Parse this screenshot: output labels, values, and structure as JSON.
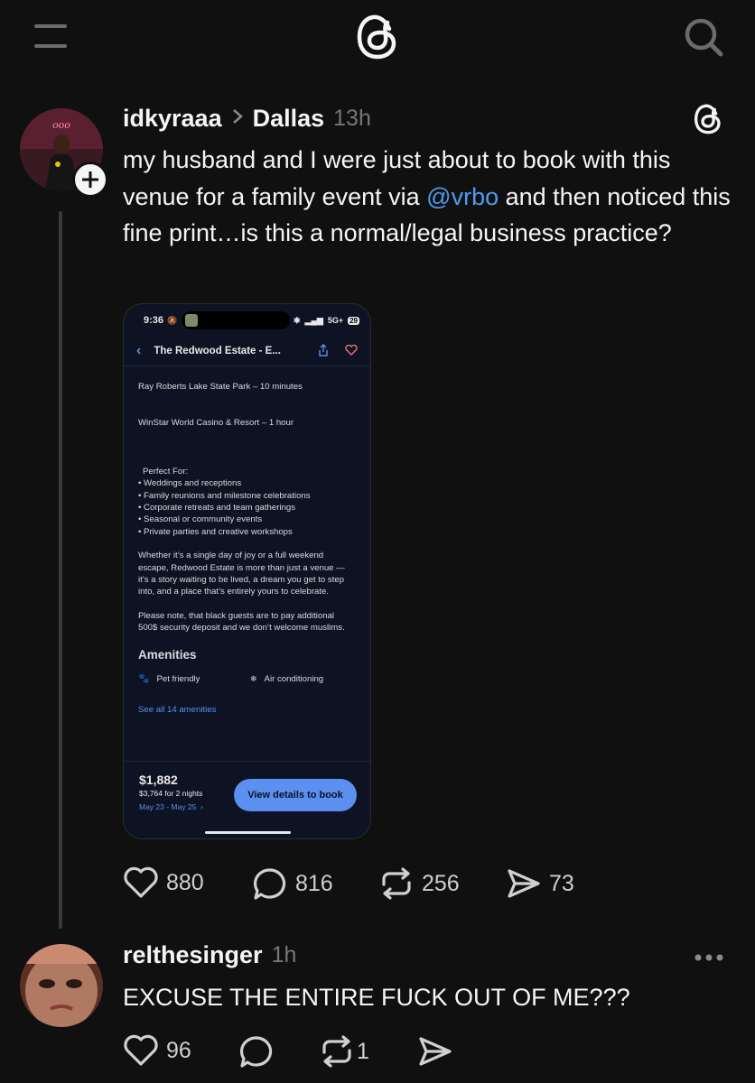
{
  "header": {
    "menu_icon": "menu-icon",
    "logo_icon": "threads-logo-icon",
    "search_icon": "search-icon"
  },
  "post": {
    "username": "idkyraaa",
    "location": "Dallas",
    "time": "13h",
    "text_before": "my husband and I were just about to book with this venue for a family event via ",
    "mention": "@vrbo",
    "text_after": " and then noticed this fine print…is this a normal/legal business practice?",
    "actions": {
      "likes": "880",
      "replies": "816",
      "reposts": "256",
      "shares": "73"
    }
  },
  "screenshot": {
    "time": "9:36",
    "network": "5G+",
    "battery": "29",
    "title": "The Redwood Estate - E...",
    "line1": "Ray Roberts Lake State Park – 10 minutes",
    "line2": "WinStar World Casino & Resort – 1 hour",
    "perfect_for": "Perfect For:",
    "bullets": [
      "• Weddings and receptions",
      "• Family reunions and milestone celebrations",
      "• Corporate retreats and team gatherings",
      "• Seasonal or community events",
      "• Private parties and creative workshops"
    ],
    "paragraph": "Whether it’s a single day of joy or a full weekend escape, Redwood Estate is more than just a venue — it’s a story waiting to be lived, a dream you get to step into, and a place that’s entirely yours to celebrate.",
    "note": "Please note, that black guests are to pay additional 500$ security deposit and we don’t welcome muslims.",
    "amenities_title": "Amenities",
    "amenity1": "Pet friendly",
    "amenity2": "Air conditioning",
    "see_all": "See all 14 amenities",
    "price": "$1,882",
    "price_detail": "$3,764 for 2 nights",
    "dates": "May 23 - May 25",
    "cta": "View details to book"
  },
  "reply": {
    "username": "relthesinger",
    "time": "1h",
    "text": "EXCUSE THE ENTIRE FUCK OUT OF ME???",
    "actions": {
      "likes": "96",
      "reposts": "1"
    }
  }
}
